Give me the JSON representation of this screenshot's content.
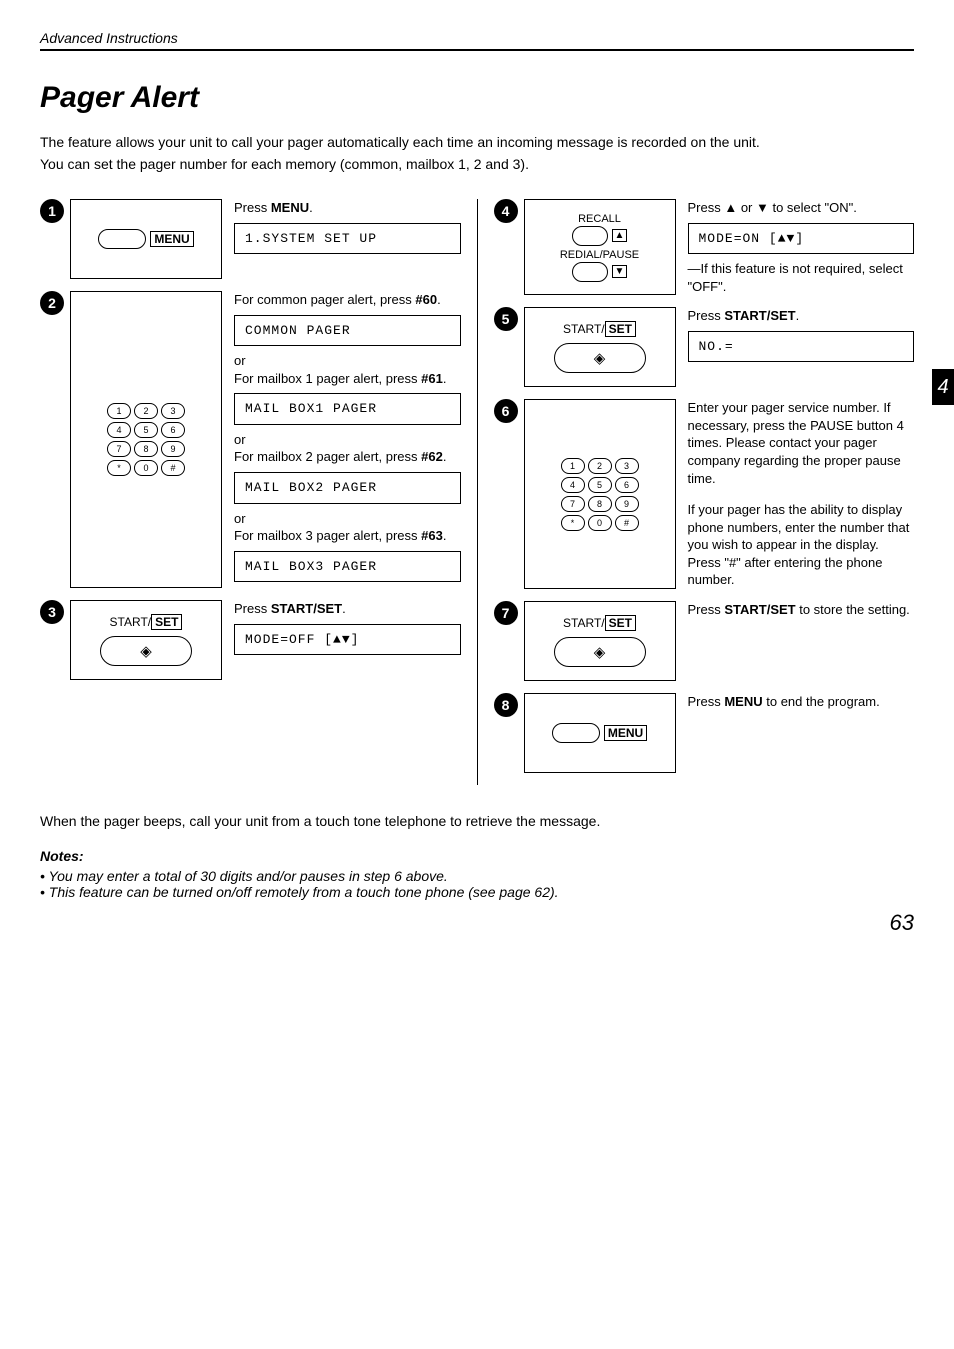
{
  "header": "Advanced Instructions",
  "title": "Pager Alert",
  "intro1": "The feature allows your unit to call your pager automatically each time an incoming message is recorded on the unit.",
  "intro2": "You can set the pager number for each memory (common, mailbox 1, 2 and 3).",
  "labels": {
    "menu": "MENU",
    "startset": "START/SET",
    "recall": "RECALL",
    "redial": "REDIAL/PAUSE"
  },
  "step1": {
    "text_pre": "Press ",
    "text_bold": "MENU",
    "text_post": ".",
    "disp": "1.SYSTEM SET UP"
  },
  "step2": {
    "line1_pre": "For common pager alert, press ",
    "line1_bold": "#60",
    "line1_post": ".",
    "disp1": "COMMON PAGER",
    "or": "or",
    "line2_pre": "For mailbox 1 pager alert, press ",
    "line2_bold": "#61",
    "line2_post": ".",
    "disp2": "MAIL BOX1 PAGER",
    "line3_pre": "For mailbox 2 pager alert, press ",
    "line3_bold": "#62",
    "line3_post": ".",
    "disp3": "MAIL BOX2 PAGER",
    "line4_pre": "For mailbox 3 pager alert, press ",
    "line4_bold": "#63",
    "line4_post": ".",
    "disp4": "MAIL BOX3 PAGER"
  },
  "step3": {
    "text_pre": "Press ",
    "text_bold": "START/SET",
    "text_post": ".",
    "disp": "MODE=OFF [▲▼]"
  },
  "step4": {
    "text": "Press ▲ or ▼ to select \"ON\".",
    "disp": "MODE=ON   [▲▼]",
    "note": "—If this feature is not required, select \"OFF\"."
  },
  "step5": {
    "text_pre": "Press ",
    "text_bold": "START/SET",
    "text_post": ".",
    "disp": "NO.="
  },
  "step6": {
    "p1": "Enter your pager service number. If necessary, press the PAUSE button 4 times. Please contact your pager company regarding the proper pause time.",
    "p2": "If your pager has the ability to display phone numbers, enter the number that you wish to appear in the display. Press \"#\" after entering the phone number."
  },
  "step7": {
    "text_pre": "Press ",
    "text_bold": "START/SET",
    "text_post": " to store the setting."
  },
  "step8": {
    "text_pre": "Press ",
    "text_bold": "MENU",
    "text_post": " to end the program."
  },
  "bottom": "When the pager beeps, call your unit from a touch tone telephone to retrieve the message.",
  "notes_title": "Notes:",
  "note1": "You may enter a total of 30 digits and/or pauses in step 6 above.",
  "note2": "This feature can be turned on/off remotely from a touch tone phone (see page 62).",
  "pagenum": "63",
  "tab": "4"
}
